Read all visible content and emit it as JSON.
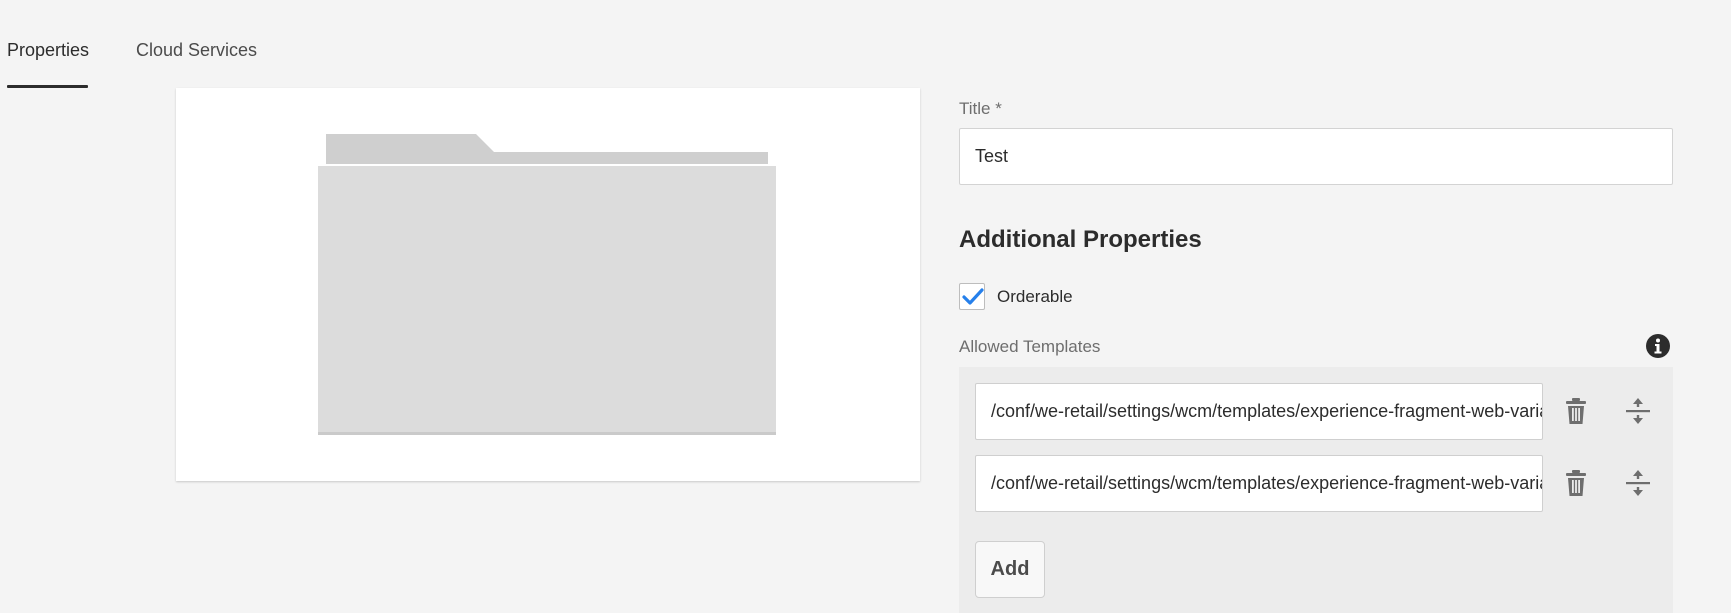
{
  "tabs": [
    {
      "label": "Properties",
      "active": true
    },
    {
      "label": "Cloud Services",
      "active": false
    }
  ],
  "thumbnail": {
    "icon": "folder-icon"
  },
  "form": {
    "title_label": "Title *",
    "title_value": "Test",
    "section_title": "Additional Properties",
    "orderable": {
      "label": "Orderable",
      "checked": true
    },
    "allowed_templates_label": "Allowed Templates",
    "allowed_templates": [
      "/conf/we-retail/settings/wcm/templates/experience-fragment-web-variation",
      "/conf/we-retail/settings/wcm/templates/experience-fragment-web-variation"
    ],
    "add_label": "Add"
  },
  "colors": {
    "accent": "#2680eb",
    "background": "#f4f4f4"
  }
}
